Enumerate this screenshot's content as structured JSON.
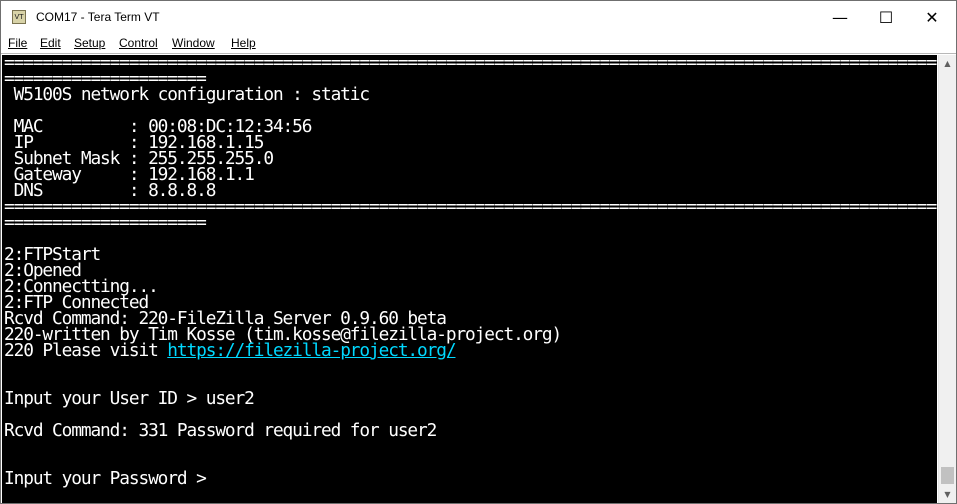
{
  "window": {
    "title": "COM17 - Tera Term VT",
    "icon_text": "VT",
    "controls": {
      "minimize": "—",
      "maximize": "☐",
      "close": "✕"
    }
  },
  "menu": [
    {
      "label": "File"
    },
    {
      "label": "Edit"
    },
    {
      "label": "Setup"
    },
    {
      "label": "Control"
    },
    {
      "label": "Window"
    },
    {
      "label": "Help"
    }
  ],
  "terminal": {
    "separator_long": "=========================================================================================================",
    "separator_short": "=====================",
    "config_title": " W5100S network configuration : static",
    "config": [
      " MAC         : 00:08:DC:12:34:56",
      " IP          : 192.168.1.15",
      " Subnet Mask : 255.255.255.0",
      " Gateway     : 192.168.1.1",
      " DNS         : 8.8.8.8"
    ],
    "log": [
      "2:FTPStart",
      "2:Opened",
      "2:Connectting...",
      "2:FTP Connected",
      "Rcvd Command: 220-FileZilla Server 0.9.60 beta",
      "220-written by Tim Kosse (tim.kosse@filezilla-project.org)"
    ],
    "visit_prefix": "220 Please visit ",
    "visit_link": "https://filezilla-project.org/",
    "user_prompt": "Input your User ID > user2",
    "rcvd_password": "Rcvd Command: 331 Password required for user2",
    "password_prompt": "Input your Password > "
  }
}
